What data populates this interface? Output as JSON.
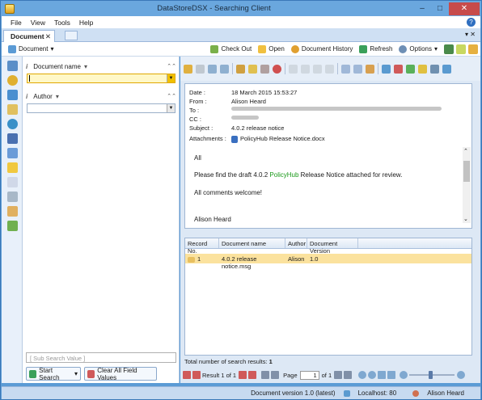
{
  "window": {
    "title": "DataStoreDSX - Searching Client",
    "minimize": "–",
    "maximize": "□",
    "close": "✕"
  },
  "menu": [
    "File",
    "View",
    "Tools",
    "Help"
  ],
  "help_label": "?",
  "tabs": {
    "document_tab": "Document",
    "close": "✕",
    "controls": "▾ ✕"
  },
  "toolbar": {
    "document_dropdown": "Document",
    "check_out": "Check Out",
    "open": "Open",
    "document_history": "Document History",
    "refresh": "Refresh",
    "options": "Options"
  },
  "search": {
    "field1_label": "Document name",
    "field2_label": "Author",
    "info_mark": "i",
    "sub_search_placeholder": "[ Sub Search Value ]",
    "start_search": "Start Search",
    "clear_all": "Clear All Field Values"
  },
  "message": {
    "date_label": "Date :",
    "date": "18 March 2015 15:53:27",
    "from_label": "From :",
    "from": "Alison Heard",
    "to_label": "To :",
    "cc_label": "CC :",
    "subject_label": "Subject :",
    "subject": "4.0.2 release notice",
    "attachments_label": "Attachments :",
    "attachment": "PolicyHub Release Notice.docx",
    "body_greeting": "All",
    "body_line1_pre": "Please find the draft 4.0.2 ",
    "body_line1_link": "PolicyHub",
    "body_line1_post": " Release Notice attached for review.",
    "body_line2": "All comments welcome!",
    "body_sign": "Alison Heard"
  },
  "results": {
    "columns": [
      "Record No.",
      "Document name",
      "Author",
      "Document Version"
    ],
    "rows": [
      {
        "record": "1",
        "name": "4.0.2 release notice.msg",
        "author": "Alison",
        "version": "1.0"
      }
    ],
    "total_label": "Total number of search results:",
    "total": "1"
  },
  "pager": {
    "result_label": "Result 1 of 1",
    "page_label": "Page",
    "page_value": "1",
    "of_label": "of 1"
  },
  "status": {
    "version": "Document version 1.0 (latest)",
    "host": "Localhost: 80",
    "user": "Alison Heard"
  },
  "colors": {
    "accent": "#5b9bd5",
    "selected_row": "#fbe29e",
    "link_green": "#1a9a1a",
    "close_red": "#c74b4b"
  }
}
